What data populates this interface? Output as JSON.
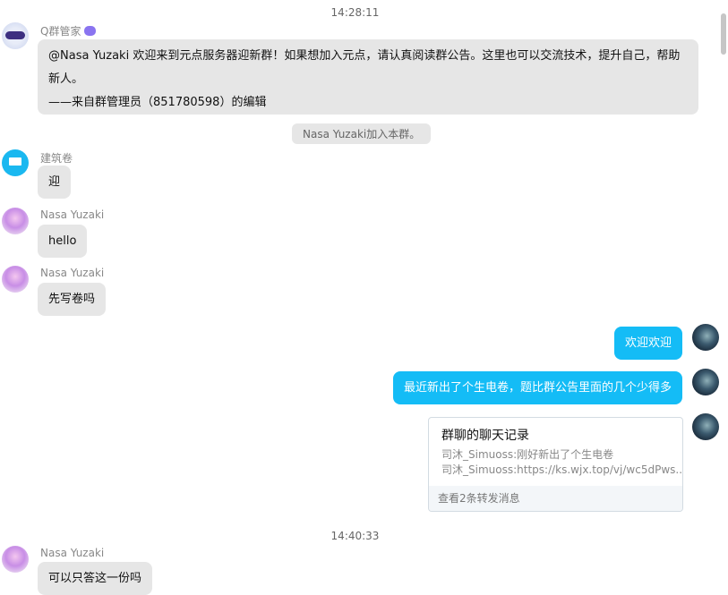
{
  "messages": {
    "t1": "14:28:11",
    "bot_name": "Q群管家",
    "bot_text": "@Nasa Yuzaki 欢迎来到元点服务器迎新群！如果想加入元点，请认真阅读群公告。这里也可以交流技术，提升自己，帮助新人。",
    "bot_sign": "——来自群管理员（851780598）的编辑",
    "sys": "Nasa Yuzaki加入本群。",
    "m1_name": "建筑卷",
    "m1_text": "迎",
    "m2_name": "Nasa Yuzaki",
    "m2_text": "hello",
    "m3_name": "Nasa Yuzaki",
    "m3_text": "先写卷吗",
    "me1": "欢迎欢迎",
    "me2": "最近新出了个生电卷，题比群公告里面的几个少得多",
    "card_title": "群聊的聊天记录",
    "card_line1": "司沐_Simuoss:刚好新出了个生电卷",
    "card_line2": "司沐_Simuoss:https://ks.wjx.top/vj/wc5dPws...",
    "card_footer": "查看2条转发消息",
    "t2": "14:40:33",
    "m4_name": "Nasa Yuzaki",
    "m4_text": "可以只答这一份吗"
  }
}
